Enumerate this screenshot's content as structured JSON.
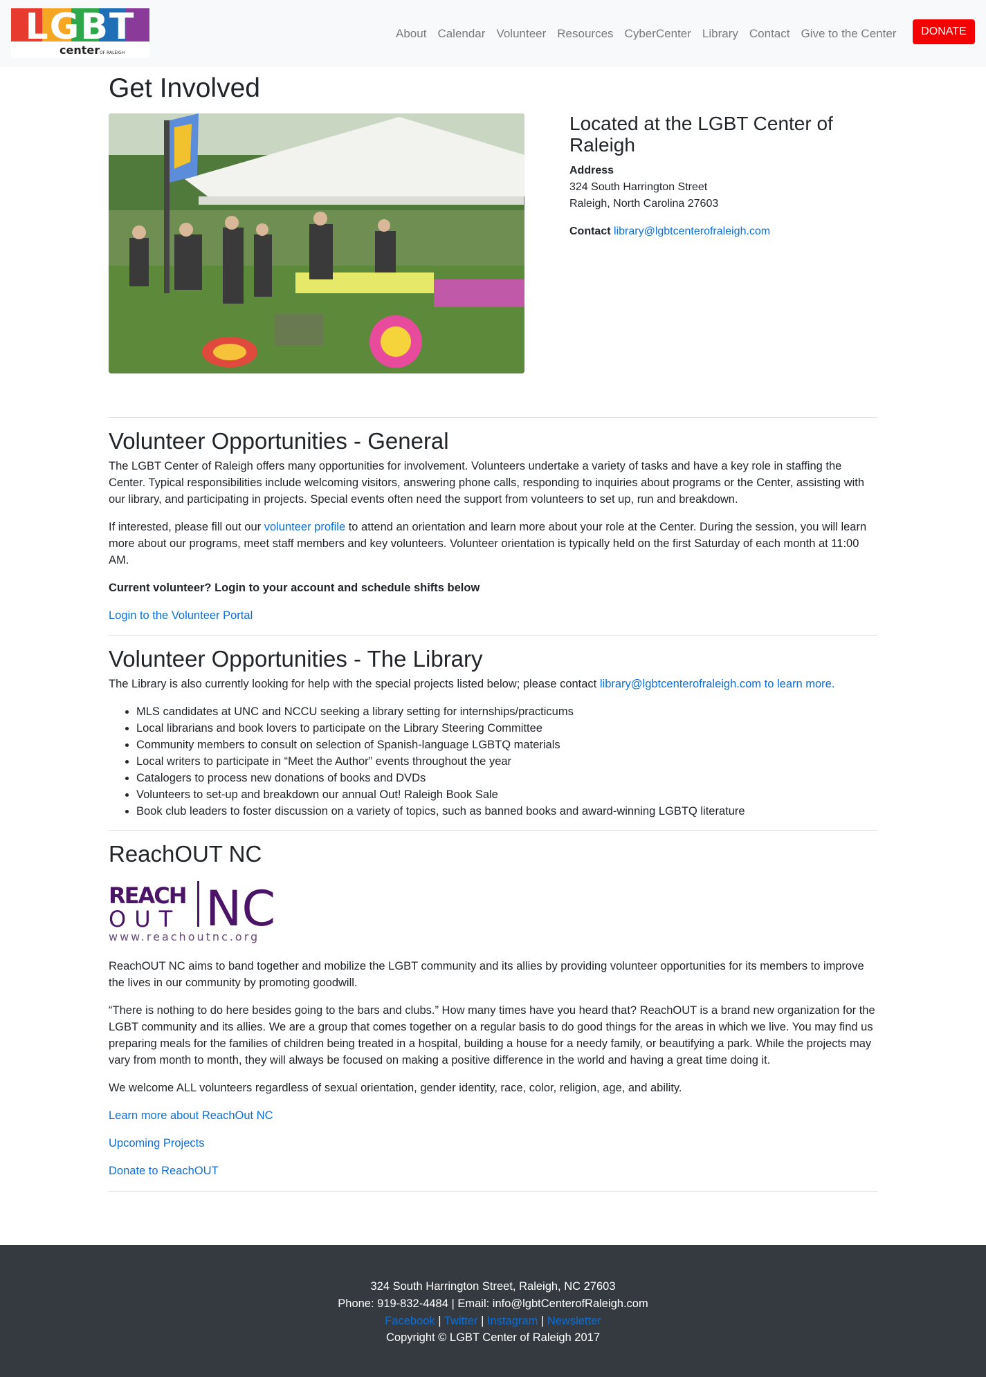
{
  "nav": {
    "logo_text": "LGBT",
    "logo_sub": "center",
    "logo_sub2": "OF RALEIGH",
    "links": [
      "About",
      "Calendar",
      "Volunteer",
      "Resources",
      "CyberCenter",
      "Library",
      "Contact",
      "Give to the Center"
    ],
    "donate": "DONATE"
  },
  "page": {
    "title": "Get Involved"
  },
  "location": {
    "heading": "Located at the LGBT Center of Raleigh",
    "address_label": "Address",
    "address_line1": "324 South Harrington Street",
    "address_line2": "Raleigh, North Carolina 27603",
    "contact_label": "Contact",
    "contact_email": "library@lgbtcenterofraleigh.com"
  },
  "general": {
    "heading": "Volunteer Opportunities - General",
    "p1": "The LGBT Center of Raleigh offers many opportunities for involvement. Volunteers undertake a variety of tasks and have a key role in staffing the Center. Typical responsibilities include welcoming visitors, answering phone calls, responding to inquiries about programs or the Center, assisting with our library, and participating in projects. Special events often need the support from volunteers to set up, run and breakdown.",
    "p2_before": "If interested, please fill out our ",
    "p2_link": "volunteer profile",
    "p2_after": " to attend an orientation and learn more about your role at the Center. During the session, you will learn more about our programs, meet staff members and key volunteers. Volunteer orientation is typically held on the first Saturday of each month at 11:00 AM.",
    "current": "Current volunteer? Login to your account and schedule shifts below",
    "portal_link": "Login to the Volunteer Portal"
  },
  "library": {
    "heading": "Volunteer Opportunities - The Library",
    "intro_before": "The Library is also currently looking for help with the special projects listed below; please contact ",
    "intro_link": "library@lgbtcenterofraleigh.com to learn more.",
    "items": [
      "MLS candidates at UNC and NCCU seeking a library setting for internships/practicums",
      "Local librarians and book lovers to participate on the Library Steering Committee",
      "Community members to consult on selection of Spanish-language LGBTQ materials",
      "Local writers to participate in “Meet the Author” events throughout the year",
      "Catalogers to process new donations of books and DVDs",
      "Volunteers to set-up and breakdown our annual Out! Raleigh Book Sale",
      "Book club leaders to foster discussion on a variety of topics, such as banned books and award-winning LGBTQ literature"
    ]
  },
  "reachout": {
    "heading": "ReachOUT NC",
    "logo_reach": "REACH",
    "logo_out": "OUT",
    "logo_nc": "NC",
    "logo_url": "www.reachoutnc.org",
    "p1": "ReachOUT NC aims to band together and mobilize the LGBT community and its allies by providing volunteer opportunities for its members to improve the lives in our community by promoting goodwill.",
    "p2": "“There is nothing to do here besides going to the bars and clubs.” How many times have you heard that? ReachOUT is a brand new organization for the LGBT community and its allies. We are a group that comes together on a regular basis to do good things for the areas in which we live. You may find us preparing meals for the families of children being treated in a hospital, building a house for a needy family, or beautifying a park. While the projects may vary from month to month, they will always be focused on making a positive difference in the world and having a great time doing it.",
    "p3": "We welcome ALL volunteers regardless of sexual orientation, gender identity, race, color, religion, age, and ability.",
    "link1": "Learn more about ReachOut NC",
    "link2": "Upcoming Projects",
    "link3": "Donate to ReachOUT"
  },
  "footer": {
    "address": "324 South Harrington Street, Raleigh, NC 27603",
    "phone_email": "Phone: 919-832-4484 | Email: info@lgbtCenterofRaleigh.com",
    "social": [
      "Facebook",
      "Twitter",
      "Instagram",
      "Newsletter"
    ],
    "sep": "|",
    "copyright": "Copyright © LGBT Center of Raleigh 2017"
  },
  "colors": {
    "donate_bg": "#f40000",
    "link": "#0b6fd9",
    "footer_bg": "#343a40",
    "reachout_purple": "#4b1466"
  }
}
